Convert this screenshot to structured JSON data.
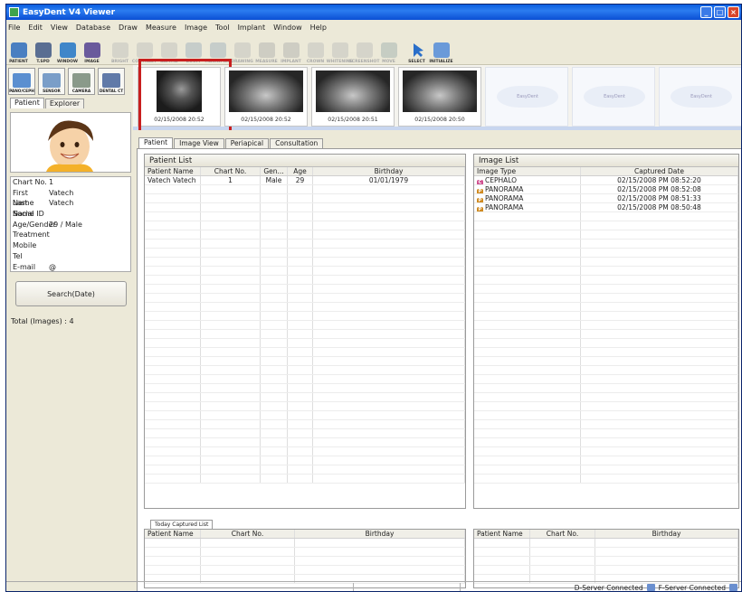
{
  "window": {
    "title": "EasyDent V4 Viewer"
  },
  "menu": [
    "File",
    "Edit",
    "View",
    "Database",
    "Draw",
    "Measure",
    "Image",
    "Tool",
    "Implant",
    "Window",
    "Help"
  ],
  "toolbar": [
    {
      "label": "PATIENT",
      "icon": "patient-icon",
      "enabled": true
    },
    {
      "label": "T.SPD",
      "icon": "tspd-icon",
      "enabled": true
    },
    {
      "label": "WINDOW",
      "icon": "window-icon",
      "enabled": true
    },
    {
      "label": "IMAGE",
      "icon": "image-icon",
      "enabled": true
    },
    {
      "label": "BRIGHT",
      "icon": "brightness-icon",
      "enabled": false
    },
    {
      "label": "CONTRAST",
      "icon": "contrast-icon",
      "enabled": false
    },
    {
      "label": "GAMMA",
      "icon": "gamma-icon",
      "enabled": false
    },
    {
      "label": "ZOOM",
      "icon": "zoom-icon",
      "enabled": false
    },
    {
      "label": "MAGNIFIER",
      "icon": "magnifier-icon",
      "enabled": false
    },
    {
      "label": "DRAWING",
      "icon": "drawing-icon",
      "enabled": false
    },
    {
      "label": "MEASURE",
      "icon": "measure-icon",
      "enabled": false
    },
    {
      "label": "IMPLANT",
      "icon": "implant-icon",
      "enabled": false
    },
    {
      "label": "CROWN",
      "icon": "crown-icon",
      "enabled": false
    },
    {
      "label": "WHITENING",
      "icon": "whitening-icon",
      "enabled": false
    },
    {
      "label": "SCREENSHOT",
      "icon": "screenshot-icon",
      "enabled": false
    },
    {
      "label": "MOVE",
      "icon": "move-icon",
      "enabled": false
    },
    {
      "label": "SELECT",
      "icon": "select-arrow-icon",
      "enabled": true
    },
    {
      "label": "INITIALIZE",
      "icon": "initialize-icon",
      "enabled": true
    }
  ],
  "modalities": [
    {
      "label": "PANO/CEPH",
      "icon": "pano-ceph-icon"
    },
    {
      "label": "SENSOR",
      "icon": "sensor-icon"
    },
    {
      "label": "CAMERA",
      "icon": "camera-icon"
    },
    {
      "label": "DENTAL CT",
      "icon": "dental-ct-icon"
    }
  ],
  "left_tabs": [
    "Patient",
    "Explorer"
  ],
  "patient_info": [
    {
      "key": "Chart No.",
      "value": "1"
    },
    {
      "key": "First Name",
      "value": "Vatech"
    },
    {
      "key": "Last Name",
      "value": "Vatech"
    },
    {
      "key": "Social ID",
      "value": ""
    },
    {
      "key": "Age/Gender",
      "value": "29 / Male"
    },
    {
      "key": "Treatment",
      "value": ""
    },
    {
      "key": "Mobile",
      "value": ""
    },
    {
      "key": "Tel",
      "value": ""
    },
    {
      "key": "E-mail",
      "value": "@"
    }
  ],
  "search_button": "Search(Date)",
  "total_images": "Total (Images) : 4",
  "thumbnails": [
    {
      "label": "02/15/2008 20:52",
      "kind": "ceph",
      "selected": true
    },
    {
      "label": "02/15/2008 20:52",
      "kind": "pano3"
    },
    {
      "label": "02/15/2008 20:51",
      "kind": "pano"
    },
    {
      "label": "02/15/2008 20:50",
      "kind": "pano2"
    },
    {
      "label": "",
      "kind": "empty",
      "placeholder": "EasyDent"
    },
    {
      "label": "",
      "kind": "empty",
      "placeholder": "EasyDent"
    },
    {
      "label": "",
      "kind": "empty",
      "placeholder": "EasyDent"
    }
  ],
  "main_tabs": [
    "Patient",
    "Image View",
    "Periapical",
    "Consultation"
  ],
  "patient_list": {
    "title": "Patient List",
    "columns": [
      "Patient Name",
      "Chart No.",
      "Gen...",
      "Age",
      "Birthday"
    ],
    "rows": [
      [
        "Vatech Vatech",
        "1",
        "Male",
        "29",
        "01/01/1979"
      ]
    ]
  },
  "image_list": {
    "title": "Image List",
    "columns": [
      "Image Type",
      "Captured Date"
    ],
    "rows": [
      {
        "type": "CEPHALO",
        "badge": "C",
        "date": "02/15/2008 PM 08:52:20"
      },
      {
        "type": "PANORAMA",
        "badge": "P",
        "date": "02/15/2008 PM 08:52:08"
      },
      {
        "type": "PANORAMA",
        "badge": "P",
        "date": "02/15/2008 PM 08:51:33"
      },
      {
        "type": "PANORAMA",
        "badge": "P",
        "date": "02/15/2008 PM 08:50:48"
      }
    ]
  },
  "today_list": {
    "tab": "Today Captured List",
    "columns": [
      "Patient Name",
      "Chart No.",
      "Birthday"
    ],
    "right_columns": [
      "Patient Name",
      "Chart No.",
      "Birthday"
    ]
  },
  "status": {
    "dserver": "D-Server Connected",
    "fserver": "F-Server Connected"
  },
  "colors": {
    "selection_frame": "#c81e1e",
    "title_bar": "#0a5ee0",
    "ceph_badge": "#d05090",
    "pano_badge": "#d08a20"
  }
}
